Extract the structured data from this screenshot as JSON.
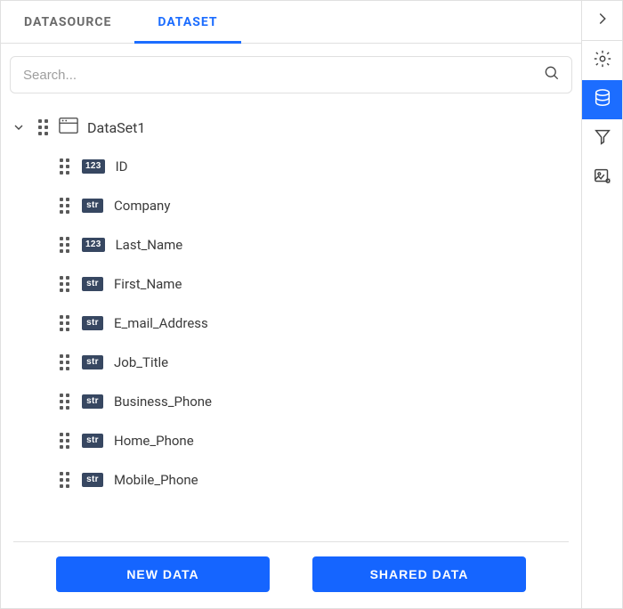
{
  "tabs": {
    "datasource": "DATASOURCE",
    "dataset": "DATASET"
  },
  "search": {
    "placeholder": "Search..."
  },
  "dataset": {
    "name": "DataSet1",
    "fields": [
      {
        "type": "123",
        "name": "ID"
      },
      {
        "type": "str",
        "name": "Company"
      },
      {
        "type": "123",
        "name": "Last_Name"
      },
      {
        "type": "str",
        "name": "First_Name"
      },
      {
        "type": "str",
        "name": "E_mail_Address"
      },
      {
        "type": "str",
        "name": "Job_Title"
      },
      {
        "type": "str",
        "name": "Business_Phone"
      },
      {
        "type": "str",
        "name": "Home_Phone"
      },
      {
        "type": "str",
        "name": "Mobile_Phone"
      }
    ]
  },
  "buttons": {
    "new_data": "NEW DATA",
    "shared_data": "SHARED DATA"
  },
  "sidebar": {
    "collapse": "collapse",
    "settings": "settings",
    "data": "data",
    "filter": "filter",
    "image": "image-settings"
  }
}
